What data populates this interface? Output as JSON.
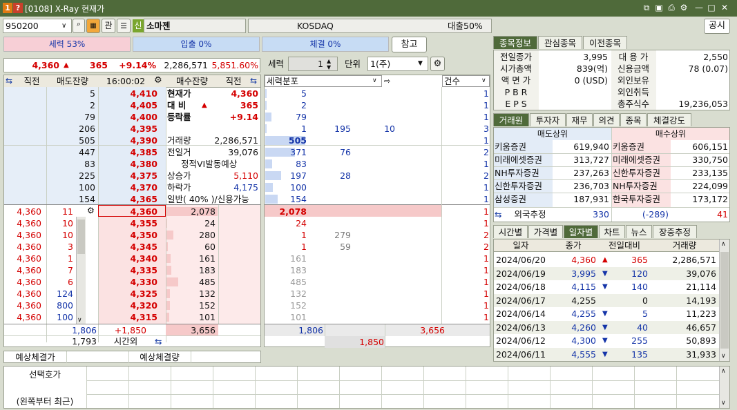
{
  "window": {
    "badge1": "1",
    "badge2": "?",
    "title": "[0108] X-Ray 현재가"
  },
  "top": {
    "code": "950200",
    "gwan": "관",
    "sin": "신",
    "name": "소마젠",
    "market": "KOSDAQ",
    "loan": "대출50%",
    "notice_btn": "공시",
    "ref_btn": "참고"
  },
  "sw": {
    "seryeok": "세력 53%",
    "ipchul": "입출 0%",
    "chegyeol": "체결 0%"
  },
  "price_line": {
    "price": "4,360",
    "change": "365",
    "pct": "+9.14%",
    "vol": "2,286,571",
    "turnover": "5,851.60%"
  },
  "ctrl": {
    "seryeok_label": "세력",
    "seryeok_val": "1",
    "unit_label": "단위",
    "unit_val": "1(주)"
  },
  "ob_hdr": {
    "c1": "직전",
    "c2": "매도잔량",
    "time": "16:00:02",
    "c4": "매수잔량",
    "c5": "직전"
  },
  "asks": [
    {
      "rem": "5",
      "price": "4,410",
      "mid": "현재가",
      "midv": "4,360"
    },
    {
      "rem": "2",
      "price": "4,405",
      "mid": "대 비",
      "midv": "365"
    },
    {
      "rem": "79",
      "price": "4,400",
      "mid": "등락률",
      "midv": "+9.14"
    },
    {
      "rem": "206",
      "price": "4,395",
      "mid": "",
      "midv": ""
    },
    {
      "rem": "505",
      "price": "4,390",
      "mid": "거래량",
      "midv": "2,286,571"
    },
    {
      "rem": "447",
      "price": "4,385",
      "mid": "전일거",
      "midv": "39,076"
    },
    {
      "rem": "83",
      "price": "4,380",
      "mid": "정적VI발동예상",
      "midv": ""
    },
    {
      "rem": "225",
      "price": "4,375",
      "mid": "상승가",
      "midv": "5,110"
    },
    {
      "rem": "100",
      "price": "4,370",
      "mid": "하락가",
      "midv": "4,175"
    },
    {
      "rem": "154",
      "price": "4,365",
      "mid": "일반( 40% )/신용가능",
      "midv": ""
    }
  ],
  "bids": [
    {
      "prev": "4,360",
      "q": "11",
      "price": "4,360",
      "rem": "2,078"
    },
    {
      "prev": "4,360",
      "q": "10",
      "price": "4,355",
      "rem": "24"
    },
    {
      "prev": "4,360",
      "q": "10",
      "price": "4,350",
      "rem": "280"
    },
    {
      "prev": "4,360",
      "q": "3",
      "price": "4,345",
      "rem": "60"
    },
    {
      "prev": "4,360",
      "q": "1",
      "price": "4,340",
      "rem": "161"
    },
    {
      "prev": "4,360",
      "q": "7",
      "price": "4,335",
      "rem": "183"
    },
    {
      "prev": "4,360",
      "q": "6",
      "price": "4,330",
      "rem": "485"
    },
    {
      "prev": "4,360",
      "q": "124",
      "price": "4,325",
      "rem": "132"
    },
    {
      "prev": "4,360",
      "q": "800",
      "price": "4,320",
      "rem": "152"
    },
    {
      "prev": "4,360",
      "q": "100",
      "price": "4,315",
      "rem": "101"
    }
  ],
  "ob_foot": {
    "ask_total": "1,806",
    "net": "+1,850",
    "bid_total": "3,656",
    "after_ask": "1,793",
    "after_label": "시간외"
  },
  "expect": {
    "price_label": "예상체결가",
    "qty_label": "예상체결량"
  },
  "dist": {
    "title": "세력분포",
    "count_label": "건수",
    "asks": [
      {
        "a": "5",
        "b": "",
        "c": "",
        "n": "1"
      },
      {
        "a": "2",
        "b": "",
        "c": "",
        "n": "1"
      },
      {
        "a": "79",
        "b": "",
        "c": "",
        "n": "1"
      },
      {
        "a": "1",
        "b": "195",
        "c": "10",
        "n": "3"
      },
      {
        "a": "505",
        "b": "",
        "c": "",
        "n": "1"
      },
      {
        "a": "371",
        "b": "76",
        "c": "",
        "n": "2"
      },
      {
        "a": "83",
        "b": "",
        "c": "",
        "n": "1"
      },
      {
        "a": "197",
        "b": "28",
        "c": "",
        "n": "2"
      },
      {
        "a": "100",
        "b": "",
        "c": "",
        "n": "1"
      },
      {
        "a": "154",
        "b": "",
        "c": "",
        "n": "1"
      }
    ],
    "bids": [
      {
        "a": "2,078",
        "b": "",
        "n": "1"
      },
      {
        "a": "24",
        "b": "",
        "n": "1"
      },
      {
        "a": "1",
        "b": "279",
        "n": "2"
      },
      {
        "a": "1",
        "b": "59",
        "n": "2"
      },
      {
        "a": "161",
        "b": "",
        "n": "1"
      },
      {
        "a": "183",
        "b": "",
        "n": "1"
      },
      {
        "a": "485",
        "b": "",
        "n": "1"
      },
      {
        "a": "132",
        "b": "",
        "n": "1"
      },
      {
        "a": "152",
        "b": "",
        "n": "1"
      },
      {
        "a": "101",
        "b": "",
        "n": "1"
      }
    ],
    "foot_ask": "1,806",
    "foot_bid": "3,656",
    "foot_net": "1,850"
  },
  "info_tabs": [
    "종목정보",
    "관심종목",
    "이전종목"
  ],
  "info": [
    {
      "l": "전일종가",
      "v": "3,995",
      "l2": "대 용 가",
      "v2": "2,550"
    },
    {
      "l": "시가총액",
      "v": "839(억)",
      "l2": "신용금액",
      "v2": "78  (0.07)"
    },
    {
      "l": "액 면 가",
      "v": "0 (USD)",
      "l2": "외인보유",
      "v2": ""
    },
    {
      "l": "P B R",
      "v": "",
      "l2": "외인취득",
      "v2": ""
    },
    {
      "l": "E P S",
      "v": "",
      "l2": "총주식수",
      "v2": "19,236,053"
    }
  ],
  "broker_tabs": [
    "거래원",
    "투자자",
    "재무",
    "의견",
    "종목",
    "체결강도"
  ],
  "broker": {
    "sell_hdr": "매도상위",
    "buy_hdr": "매수상위",
    "rows": [
      {
        "s": "키움증권",
        "sv": "619,940",
        "b": "키움증권",
        "bv": "606,151"
      },
      {
        "s": "미래에셋증권",
        "sv": "313,727",
        "b": "미래에셋증권",
        "bv": "330,750"
      },
      {
        "s": "NH투자증권",
        "sv": "237,263",
        "b": "신한투자증권",
        "bv": "233,135"
      },
      {
        "s": "신한투자증권",
        "sv": "236,703",
        "b": "NH투자증권",
        "bv": "224,099"
      },
      {
        "s": "삼성증권",
        "sv": "187,931",
        "b": "한국투자증권",
        "bv": "173,172"
      }
    ],
    "foreign_label": "외국추정",
    "f1": "330",
    "f2": "(-289)",
    "f3": "41"
  },
  "daily_tabs": [
    "시간별",
    "가격별",
    "일자별",
    "차트",
    "뉴스",
    "장중추정"
  ],
  "daily": {
    "h1": "일자",
    "h2": "종가",
    "h3": "전일대비",
    "h4": "거래량",
    "rows": [
      {
        "d": "2024/06/20",
        "c": "4,360",
        "dir": "▲",
        "ch": "365",
        "v": "2,286,571",
        "cls": "r"
      },
      {
        "d": "2024/06/19",
        "c": "3,995",
        "dir": "▼",
        "ch": "120",
        "v": "39,076",
        "cls": "b"
      },
      {
        "d": "2024/06/18",
        "c": "4,115",
        "dir": "▼",
        "ch": "140",
        "v": "21,114",
        "cls": "b"
      },
      {
        "d": "2024/06/17",
        "c": "4,255",
        "dir": "",
        "ch": "0",
        "v": "14,193",
        "cls": "k"
      },
      {
        "d": "2024/06/14",
        "c": "4,255",
        "dir": "▼",
        "ch": "5",
        "v": "11,223",
        "cls": "b"
      },
      {
        "d": "2024/06/13",
        "c": "4,260",
        "dir": "▼",
        "ch": "40",
        "v": "46,657",
        "cls": "b"
      },
      {
        "d": "2024/06/12",
        "c": "4,300",
        "dir": "▼",
        "ch": "255",
        "v": "50,893",
        "cls": "b"
      },
      {
        "d": "2024/06/11",
        "c": "4,555",
        "dir": "▼",
        "ch": "135",
        "v": "31,933",
        "cls": "b"
      }
    ]
  },
  "bottom": {
    "sel_label": "선택호가",
    "recent_label": "(왼쪽부터 최근)"
  }
}
